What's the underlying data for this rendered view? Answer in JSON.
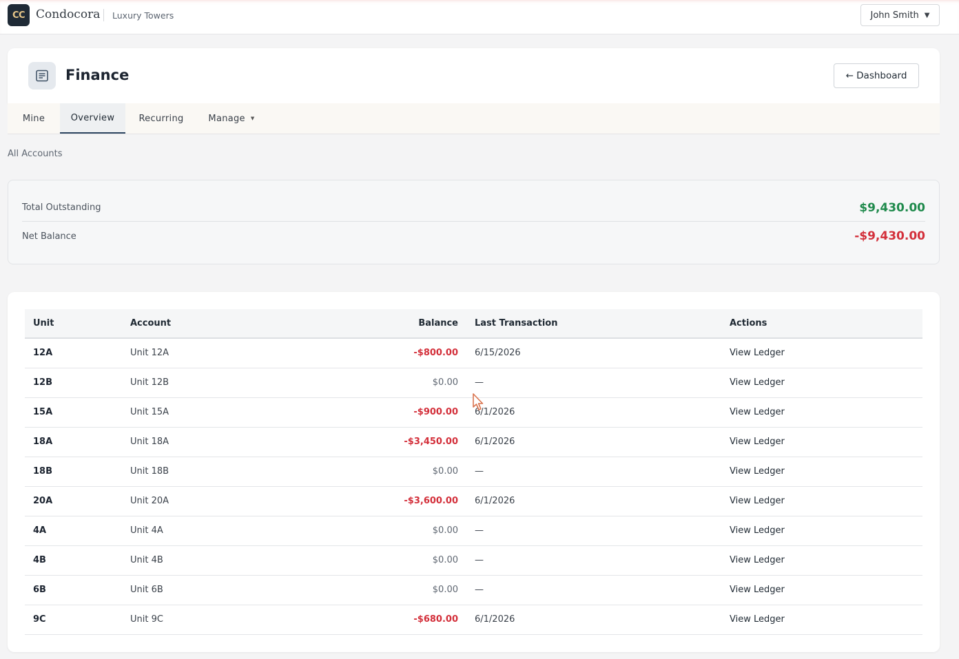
{
  "topbar": {
    "logo_text": "CC",
    "brand": "Condocora",
    "property": "Luxury Towers",
    "user": "John Smith",
    "user_caret": "▼"
  },
  "header": {
    "title": "Finance",
    "icon": "document-list-icon",
    "back_button": "← Dashboard"
  },
  "tabs": [
    {
      "label": "Mine",
      "active": false
    },
    {
      "label": "Overview",
      "active": true
    },
    {
      "label": "Recurring",
      "active": false
    },
    {
      "label": "Manage",
      "active": false,
      "dropdown": true
    }
  ],
  "tab_caret": "▼",
  "section_label": "All Accounts",
  "summary": {
    "total_outstanding_label": "Total Outstanding",
    "total_outstanding_value": "$9,430.00",
    "net_balance_label": "Net Balance",
    "net_balance_value": "-$9,430.00"
  },
  "table": {
    "headers": {
      "unit": "Unit",
      "account": "Account",
      "balance": "Balance",
      "last": "Last Transaction",
      "actions": "Actions"
    },
    "rows": [
      {
        "unit": "12A",
        "account": "Unit 12A",
        "balance": "-$800.00",
        "negative": true,
        "last": "6/15/2026",
        "action": "View Ledger"
      },
      {
        "unit": "12B",
        "account": "Unit 12B",
        "balance": "$0.00",
        "negative": false,
        "last": "—",
        "action": "View Ledger"
      },
      {
        "unit": "15A",
        "account": "Unit 15A",
        "balance": "-$900.00",
        "negative": true,
        "last": "6/1/2026",
        "action": "View Ledger"
      },
      {
        "unit": "18A",
        "account": "Unit 18A",
        "balance": "-$3,450.00",
        "negative": true,
        "last": "6/1/2026",
        "action": "View Ledger"
      },
      {
        "unit": "18B",
        "account": "Unit 18B",
        "balance": "$0.00",
        "negative": false,
        "last": "—",
        "action": "View Ledger"
      },
      {
        "unit": "20A",
        "account": "Unit 20A",
        "balance": "-$3,600.00",
        "negative": true,
        "last": "6/1/2026",
        "action": "View Ledger"
      },
      {
        "unit": "4A",
        "account": "Unit 4A",
        "balance": "$0.00",
        "negative": false,
        "last": "—",
        "action": "View Ledger"
      },
      {
        "unit": "4B",
        "account": "Unit 4B",
        "balance": "$0.00",
        "negative": false,
        "last": "—",
        "action": "View Ledger"
      },
      {
        "unit": "6B",
        "account": "Unit 6B",
        "balance": "$0.00",
        "negative": false,
        "last": "—",
        "action": "View Ledger"
      },
      {
        "unit": "9C",
        "account": "Unit 9C",
        "balance": "-$680.00",
        "negative": true,
        "last": "6/1/2026",
        "action": "View Ledger"
      }
    ]
  },
  "colors": {
    "positive": "#1f8a4c",
    "negative": "#d32f3a",
    "accent": "#2d4560"
  }
}
